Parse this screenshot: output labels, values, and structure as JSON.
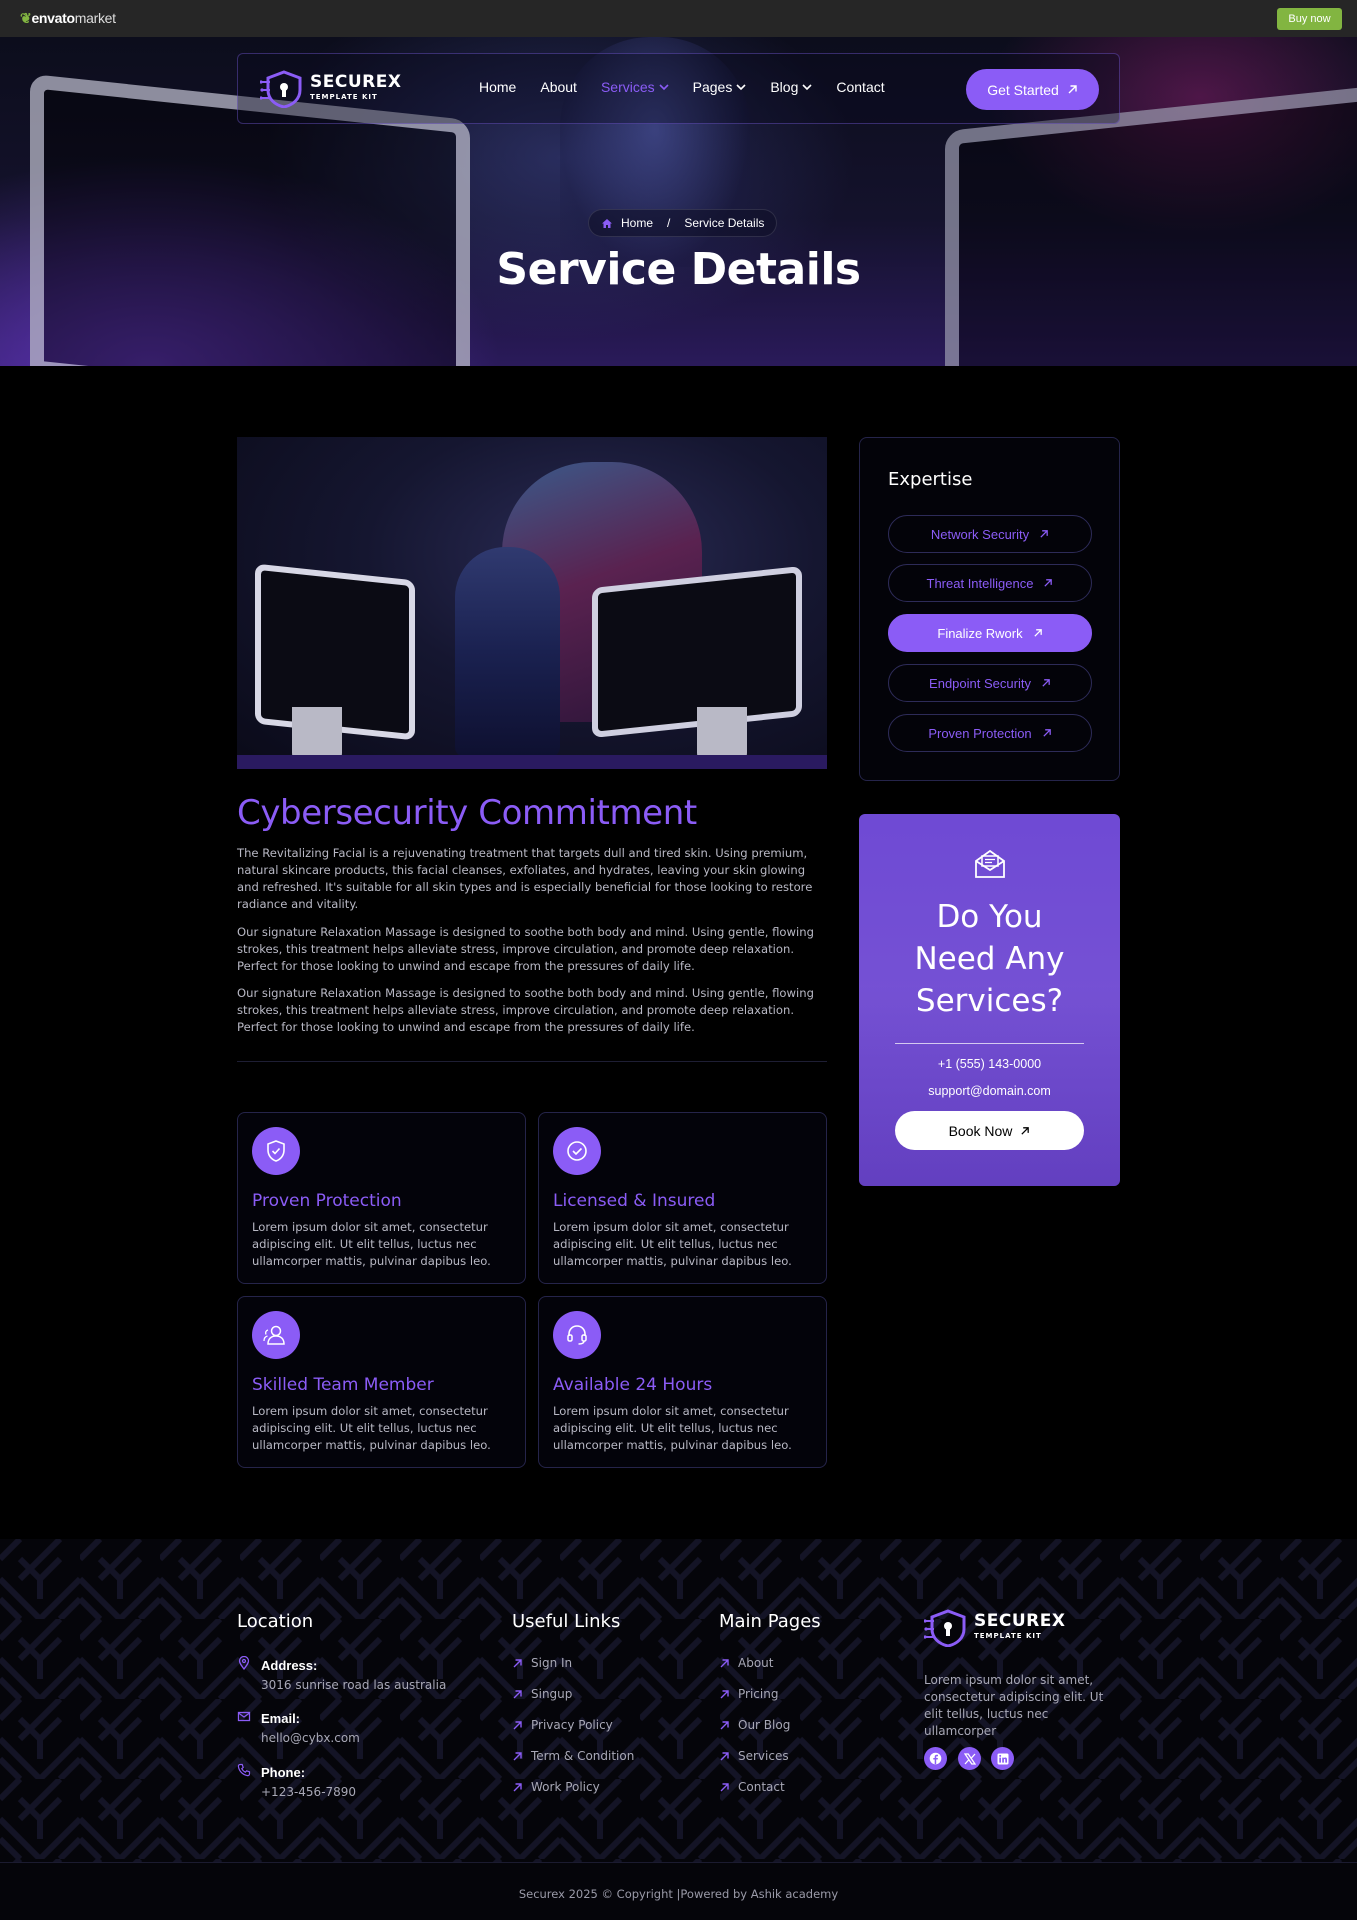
{
  "envato": {
    "logo_main": "envato",
    "logo_market": "market",
    "buy_now": "Buy now"
  },
  "brand": {
    "name_main": "SECURE",
    "name_x": "X",
    "tagline": "TEMPLATE KIT"
  },
  "nav": {
    "items": [
      {
        "label": "Home",
        "dropdown": false,
        "active": false
      },
      {
        "label": "About",
        "dropdown": false,
        "active": false
      },
      {
        "label": "Services",
        "dropdown": true,
        "active": true
      },
      {
        "label": "Pages",
        "dropdown": true,
        "active": false
      },
      {
        "label": "Blog",
        "dropdown": true,
        "active": false
      },
      {
        "label": "Contact",
        "dropdown": false,
        "active": false
      }
    ],
    "cta_label": "Get Started"
  },
  "hero": {
    "breadcrumb_home": "Home",
    "breadcrumb_separator": "/",
    "breadcrumb_current": "Service Details",
    "title": "Service Details"
  },
  "content": {
    "title": "Cybersecurity Commitment",
    "paragraphs": [
      "The Revitalizing Facial is a rejuvenating treatment that targets dull and tired skin. Using premium, natural skincare products, this facial cleanses, exfoliates, and hydrates, leaving your skin glowing and refreshed. It's suitable for all skin types and is especially beneficial for those looking to restore radiance and vitality.",
      "Our signature Relaxation Massage is designed to soothe both body and mind. Using gentle, flowing strokes, this treatment helps alleviate stress, improve circulation, and promote deep relaxation. Perfect for those looking to unwind and escape from the pressures of daily life.",
      "Our signature Relaxation Massage is designed to soothe both body and mind. Using gentle, flowing strokes, this treatment helps alleviate stress, improve circulation, and promote deep relaxation. Perfect for those looking to unwind and escape from the pressures of daily life."
    ]
  },
  "features": [
    {
      "title": "Proven Protection",
      "desc": "Lorem ipsum dolor sit amet, consectetur adipiscing elit. Ut elit tellus, luctus nec ullamcorper mattis, pulvinar dapibus leo.",
      "icon": "shield-check-icon"
    },
    {
      "title": "Licensed & Insured",
      "desc": "Lorem ipsum dolor sit amet, consectetur adipiscing elit. Ut elit tellus, luctus nec ullamcorper mattis, pulvinar dapibus leo.",
      "icon": "check-circle-icon"
    },
    {
      "title": "Skilled Team Member",
      "desc": "Lorem ipsum dolor sit amet, consectetur adipiscing elit. Ut elit tellus, luctus nec ullamcorper mattis, pulvinar dapibus leo.",
      "icon": "team-icon"
    },
    {
      "title": "Available 24 Hours",
      "desc": "Lorem ipsum dolor sit amet, consectetur adipiscing elit. Ut elit tellus, luctus nec ullamcorper mattis, pulvinar dapibus leo.",
      "icon": "headset-icon"
    }
  ],
  "expertise": {
    "title": "Expertise",
    "items": [
      {
        "label": "Network Security",
        "active": false
      },
      {
        "label": "Threat Intelligence",
        "active": false
      },
      {
        "label": "Finalize Rwork",
        "active": true
      },
      {
        "label": "Endpoint Security",
        "active": false
      },
      {
        "label": "Proven Protection",
        "active": false
      }
    ]
  },
  "cta": {
    "title_line1": "Do You",
    "title_line2": "Need Any",
    "title_line3": "Services?",
    "phone": "+1 (555) 143-0000",
    "email": "support@domain.com",
    "button": "Book Now"
  },
  "footer": {
    "location": {
      "title": "Location",
      "address_label": "Address:",
      "address_value": "3016 sunrise road las australia",
      "email_label": "Email:",
      "email_value": "hello@cybx.com",
      "phone_label": "Phone:",
      "phone_value": "+123-456-7890"
    },
    "useful_links": {
      "title": "Useful Links",
      "items": [
        "Sign In",
        "Singup",
        "Privacy Policy",
        "Term & Condition",
        "Work Policy"
      ]
    },
    "main_pages": {
      "title": "Main Pages",
      "items": [
        "About",
        "Pricing",
        "Our Blog",
        "Services",
        "Contact"
      ]
    },
    "description": "Lorem ipsum dolor sit amet, consectetur adipiscing elit. Ut elit tellus, luctus nec ullamcorper",
    "social": [
      "facebook-icon",
      "x-twitter-icon",
      "linkedin-icon"
    ],
    "copyright": "Securex 2025 © Copyright |Powered by Ashik academy"
  },
  "colors": {
    "accent": "#8b5cf6",
    "background": "#000000",
    "envato_green": "#82b541"
  }
}
